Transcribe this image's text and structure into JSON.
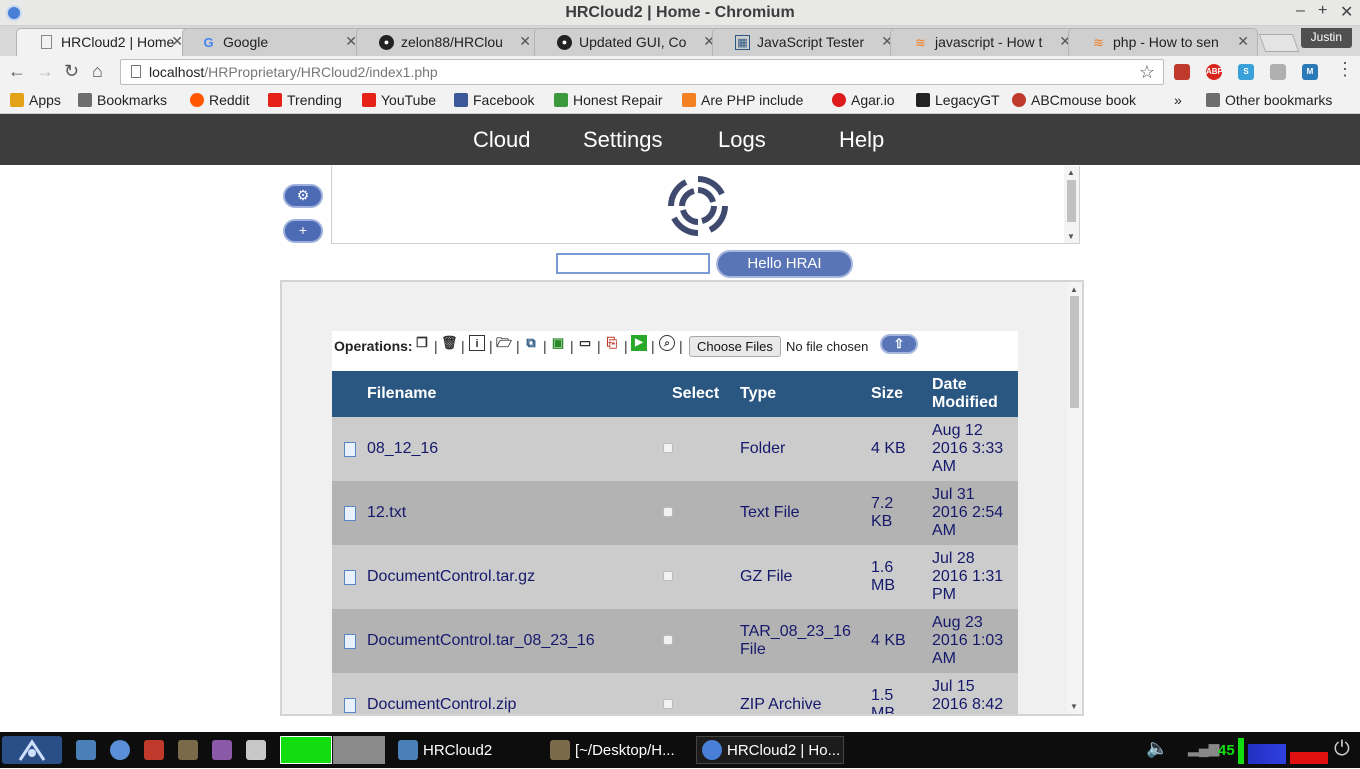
{
  "window": {
    "title": "HRCloud2 | Home - Chromium",
    "minimize": "–",
    "maximize": "+",
    "close": "✕"
  },
  "tabs": [
    {
      "label": "HRCloud2 | Home",
      "icon": "page-icon"
    },
    {
      "label": "Google",
      "icon": "google-icon"
    },
    {
      "label": "zelon88/HRClou",
      "icon": "github-icon"
    },
    {
      "label": "Updated GUI, Co",
      "icon": "github-icon"
    },
    {
      "label": "JavaScript Tester",
      "icon": "grid-icon"
    },
    {
      "label": "javascript - How t",
      "icon": "stackoverflow-icon"
    },
    {
      "label": "php - How to sen",
      "icon": "stackoverflow-icon"
    }
  ],
  "profile": "Justin",
  "address": {
    "host": "localhost",
    "path": "/HRProprietary/HRCloud2/index1.php"
  },
  "bookmarks": [
    {
      "label": "Apps",
      "color": "#e3a21a"
    },
    {
      "label": "Bookmarks",
      "color": "#6d6d6d"
    },
    {
      "label": "Reddit",
      "color": "#ff5700"
    },
    {
      "label": "Trending",
      "color": "#e62117"
    },
    {
      "label": "YouTube",
      "color": "#e62117"
    },
    {
      "label": "Facebook",
      "color": "#3b5998"
    },
    {
      "label": "Honest Repair",
      "color": "#3c9a3c"
    },
    {
      "label": "Are PHP include",
      "color": "#f48024"
    },
    {
      "label": "Agar.io",
      "color": "#e01b1b"
    },
    {
      "label": "LegacyGT",
      "color": "#222222"
    },
    {
      "label": "ABCmouse book",
      "color": "#c0392b"
    }
  ],
  "bookmarks_more": "»",
  "other_bookmarks": "Other bookmarks",
  "nav": {
    "cloud": "Cloud",
    "settings": "Settings",
    "logs": "Logs",
    "help": "Help"
  },
  "side_buttons": {
    "settings": "⚙",
    "add": "+"
  },
  "hrai_button": "Hello HRAI",
  "operations": {
    "label": "Operations:",
    "choose_files": "Choose Files",
    "no_file": "No file chosen",
    "upload": "⇧"
  },
  "table": {
    "headers": {
      "filename": "Filename",
      "select": "Select",
      "type": "Type",
      "size": "Size",
      "date_line1": "Date",
      "date_line2": "Modified"
    },
    "rows": [
      {
        "name": "08_12_16",
        "type": "Folder",
        "type2": "",
        "size": "4 KB",
        "size2": "",
        "date1": "Aug 12",
        "date2": "2016 3:33",
        "date3": "AM"
      },
      {
        "name": "12.txt",
        "type": "Text File",
        "type2": "",
        "size": "7.2",
        "size2": "KB",
        "date1": "Jul 31",
        "date2": "2016 2:54",
        "date3": "AM"
      },
      {
        "name": "DocumentControl.tar.gz",
        "type": "GZ File",
        "type2": "",
        "size": "1.6",
        "size2": "MB",
        "date1": "Jul 28",
        "date2": "2016 1:31",
        "date3": "PM"
      },
      {
        "name": "DocumentControl.tar_08_23_16",
        "type": "TAR_08_23_16",
        "type2": "File",
        "size": "4 KB",
        "size2": "",
        "date1": "Aug 23",
        "date2": "2016 1:03",
        "date3": "AM"
      },
      {
        "name": "DocumentControl.zip",
        "type": "ZIP Archive",
        "type2": "",
        "size": "1.5",
        "size2": "MB",
        "date1": "Jul 15",
        "date2": "2016 8:42",
        "date3": ""
      }
    ]
  },
  "taskbar": {
    "tasks": [
      "HRCloud2",
      "[~/Desktop/H...",
      "HRCloud2 | Ho..."
    ],
    "tray_number": "45"
  }
}
